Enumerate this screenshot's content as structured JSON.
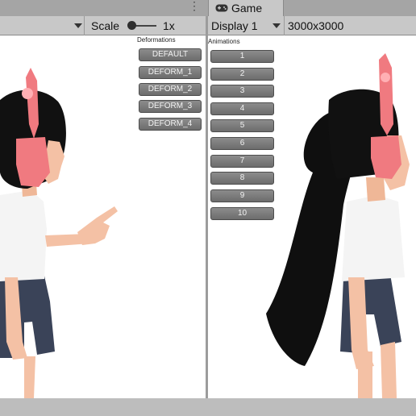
{
  "scene_toolbar": {
    "scale_label": "Scale",
    "scale_value": "1x"
  },
  "game_tab": {
    "label": "Game"
  },
  "game_toolbar": {
    "display_value": "Display 1",
    "resolution_value": "3000x3000"
  },
  "deformations": {
    "title": "Deformations",
    "buttons": [
      "DEFAULT",
      "DEFORM_1",
      "DEFORM_2",
      "DEFORM_3",
      "DEFORM_4"
    ]
  },
  "animations": {
    "title": "Animations",
    "buttons": [
      "1",
      "2",
      "3",
      "4",
      "5",
      "6",
      "7",
      "8",
      "9",
      "10"
    ]
  },
  "icons": {
    "game_tab": "gamepad-icon",
    "more": "more-vertical-icon",
    "dropdown": "chevron-down-icon"
  },
  "colors": {
    "headphone": "#f07a80",
    "shirt": "#f4f4f4",
    "shorts": "#3a4358",
    "skin": "#f4c1a5",
    "hair": "#111111"
  }
}
